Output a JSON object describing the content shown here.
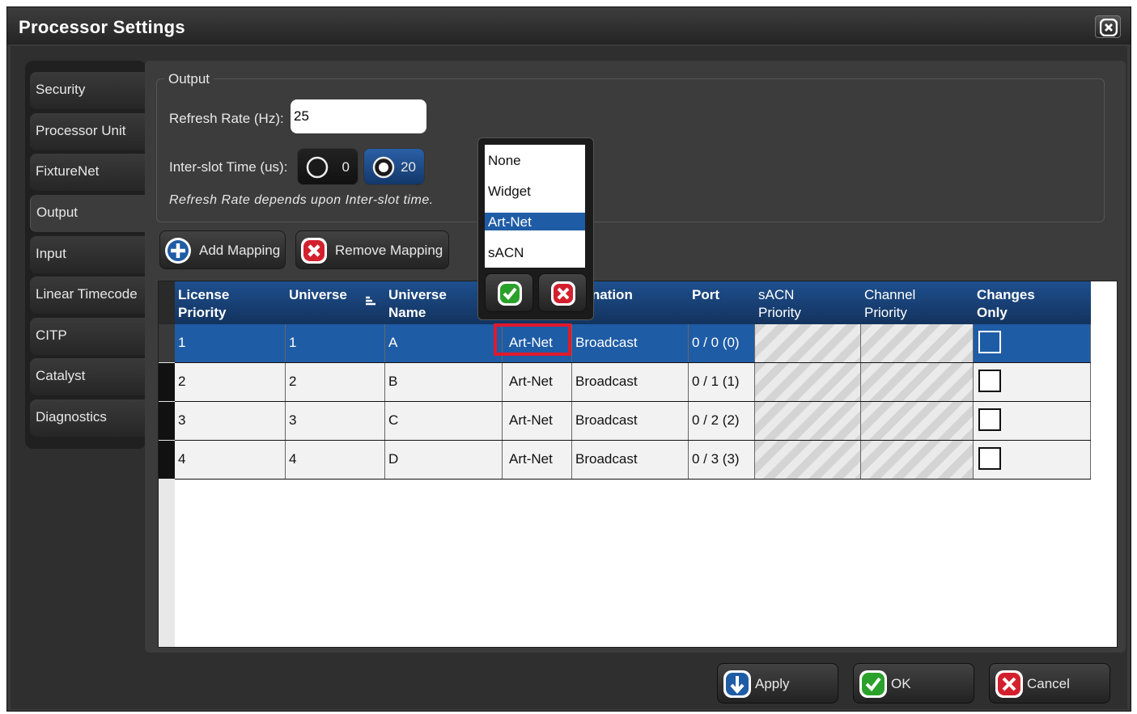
{
  "window": {
    "title": "Processor Settings"
  },
  "sidebar": {
    "tabs": [
      {
        "label": "Security"
      },
      {
        "label": "Processor Unit"
      },
      {
        "label": "FixtureNet"
      },
      {
        "label": "Output",
        "active": true
      },
      {
        "label": "Input"
      },
      {
        "label": "Linear Timecode"
      },
      {
        "label": "CITP"
      },
      {
        "label": "Catalyst"
      },
      {
        "label": "Diagnostics"
      }
    ]
  },
  "output": {
    "group_label": "Output",
    "refresh_rate_label": "Refresh Rate (Hz):",
    "refresh_rate_value": "25",
    "interslot_label": "Inter-slot Time (us):",
    "interslot_options": [
      {
        "value": "0",
        "selected": false
      },
      {
        "value": "20",
        "selected": true
      }
    ],
    "note": "Refresh Rate depends upon Inter-slot time.",
    "add_mapping": "Add Mapping",
    "remove_mapping": "Remove Mapping"
  },
  "table": {
    "headers": [
      "License\nPriority",
      "Universe",
      "Universe\nName",
      "",
      "stination",
      "Port",
      "sACN\nPriority",
      "Channel\nPriority",
      "Changes\nOnly"
    ],
    "rows": [
      {
        "license_priority": "1",
        "universe": "1",
        "name": "A",
        "protocol": "Art-Net",
        "destination": "Broadcast",
        "port": "0 / 0 (0)",
        "changes_only": false,
        "selected": true
      },
      {
        "license_priority": "2",
        "universe": "2",
        "name": "B",
        "protocol": "Art-Net",
        "destination": "Broadcast",
        "port": "0 / 1 (1)",
        "changes_only": false,
        "selected": false
      },
      {
        "license_priority": "3",
        "universe": "3",
        "name": "C",
        "protocol": "Art-Net",
        "destination": "Broadcast",
        "port": "0 / 2 (2)",
        "changes_only": false,
        "selected": false
      },
      {
        "license_priority": "4",
        "universe": "4",
        "name": "D",
        "protocol": "Art-Net",
        "destination": "Broadcast",
        "port": "0 / 3 (3)",
        "changes_only": false,
        "selected": false
      }
    ]
  },
  "protocol_dropdown": {
    "options": [
      "None",
      "Widget",
      "Art-Net",
      "sACN"
    ],
    "selected": "Art-Net"
  },
  "footer": {
    "apply": "Apply",
    "ok": "OK",
    "cancel": "Cancel"
  },
  "colors": {
    "accent_blue": "#1f5ca6",
    "header_blue": "#1e4f8e",
    "highlight_red": "#e0192e",
    "ok_green": "#2aa12a",
    "cancel_red": "#d3202e"
  },
  "icons": [
    "close-icon",
    "plus-icon",
    "remove-icon",
    "sort-icon",
    "check-icon",
    "cancel-icon",
    "apply-arrow-icon"
  ]
}
